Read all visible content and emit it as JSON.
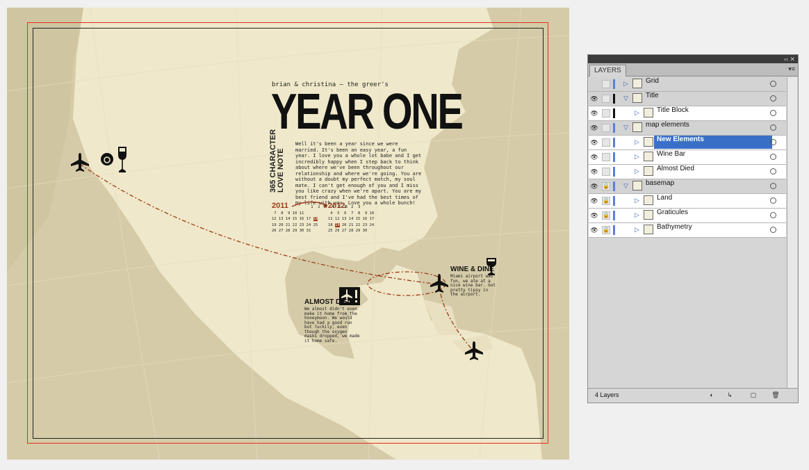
{
  "document": {
    "byline": "brian & christina – the greer's",
    "title": "YEAR ONE",
    "side_line1": "365 CHARACTER",
    "side_line2": "LOVE NOTE",
    "body": "Well it's been a year since we were married. It's been an easy year, a fun year. I love you a whole lot babe and I get incredibly happy when I step back to think about where we've been throughout our relationship and where we're going. You are without a doubt my perfect match, my soul mate. I can't get enough of you and I miss you like crazy when we're apart. You are my best friend and I've had the best times of my life with you. Love you a whole bunch!",
    "cal_left_year": "2011",
    "cal_right_year": "2012",
    "wine_title": "WINE & DINE",
    "wine_text": "Miami airport was fun, we ate at a nice wine bar. Got pretty tipsy in the airport.",
    "died_title": "ALMOST DIED",
    "died_text": "We almost didn't even make it home from the honeymoon. We would have had a good run but luckily, even though the oxygen masks dropped, we made it home safe.",
    "accent_color": "#9c3b1a"
  },
  "layers_panel": {
    "tab": "LAYERS",
    "footer_count": "4 Layers",
    "layers": [
      {
        "name": "Grid",
        "visible": false,
        "locked": false,
        "group": true,
        "expanded": false,
        "color": "#5b7fd6",
        "level": 0
      },
      {
        "name": "Title",
        "visible": true,
        "locked": false,
        "group": true,
        "expanded": true,
        "color": "#111111",
        "level": 0
      },
      {
        "name": "Title Block",
        "visible": true,
        "locked": false,
        "group": false,
        "expanded": false,
        "color": "#111111",
        "level": 1
      },
      {
        "name": "map elements",
        "visible": true,
        "locked": false,
        "group": true,
        "expanded": true,
        "color": "#5b7fd6",
        "level": 0
      },
      {
        "name": "New Elements",
        "visible": true,
        "locked": false,
        "group": false,
        "expanded": false,
        "color": "#5b7fd6",
        "level": 1,
        "selected": true
      },
      {
        "name": "Wine Bar",
        "visible": true,
        "locked": false,
        "group": false,
        "expanded": false,
        "color": "#5b7fd6",
        "level": 1
      },
      {
        "name": "Almost Died",
        "visible": true,
        "locked": false,
        "group": false,
        "expanded": false,
        "color": "#5b7fd6",
        "level": 1
      },
      {
        "name": "basemap",
        "visible": true,
        "locked": true,
        "group": true,
        "expanded": true,
        "color": "#5b7fd6",
        "level": 0
      },
      {
        "name": "Land",
        "visible": true,
        "locked": true,
        "group": false,
        "expanded": false,
        "color": "#5b7fd6",
        "level": 1
      },
      {
        "name": "Graticules",
        "visible": true,
        "locked": true,
        "group": false,
        "expanded": false,
        "color": "#5b7fd6",
        "level": 1
      },
      {
        "name": "Bathymetry",
        "visible": true,
        "locked": true,
        "group": false,
        "expanded": false,
        "color": "#5b7fd6",
        "level": 1
      }
    ]
  }
}
